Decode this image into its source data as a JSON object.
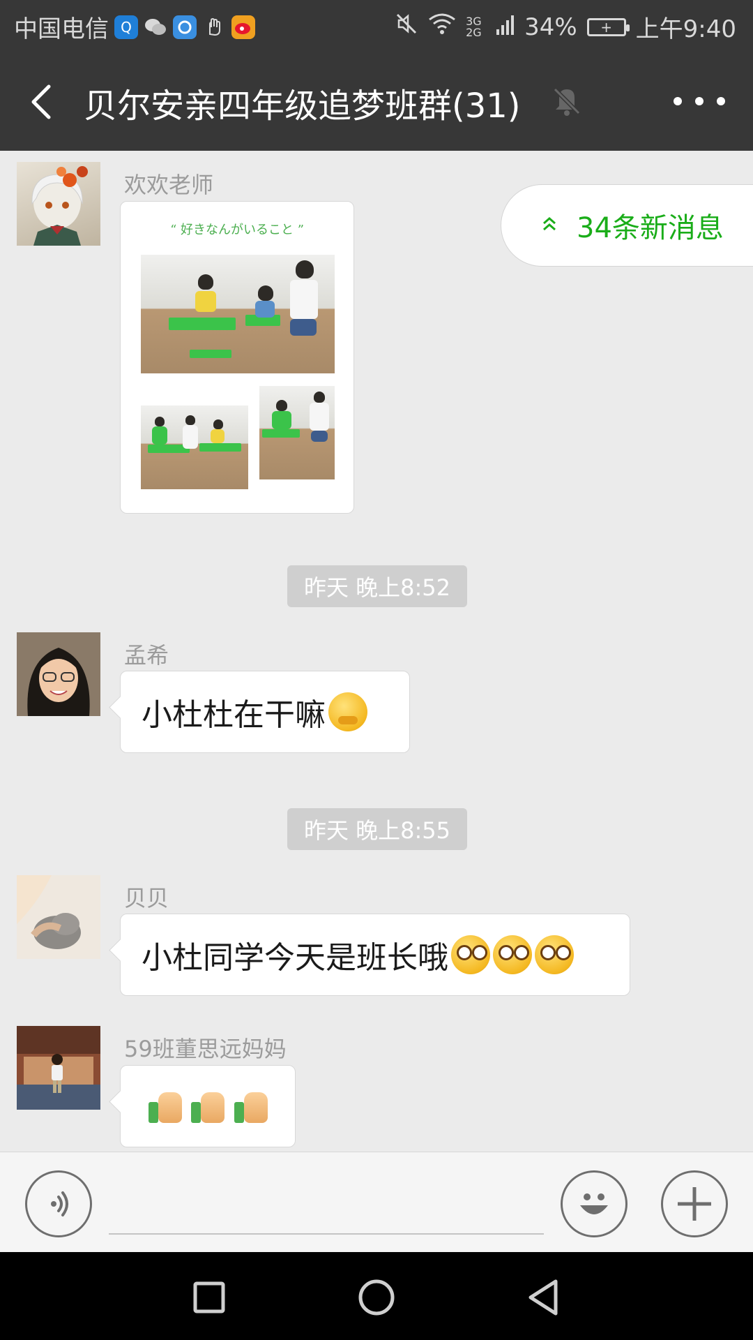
{
  "status_bar": {
    "carrier": "中国电信",
    "battery": "34%",
    "time": "上午9:40",
    "network": "3G 2G",
    "apps": [
      "qq-browser-icon",
      "wechat-icon",
      "qq-icon",
      "hand-icon",
      "weibo-icon"
    ]
  },
  "header": {
    "title": "贝尔安亲四年级追梦班群(31)",
    "back_icon": "chevron-left-icon",
    "mute_icon": "bell-off-icon",
    "more_icon": "more-dots-icon"
  },
  "new_messages_pill": {
    "label": "34条新消息"
  },
  "messages": [
    {
      "sender": "欢欢老师",
      "type": "image",
      "image_caption": "“ 好きなんがいること ”"
    },
    {
      "type": "timestamp",
      "text": "昨天 晚上8:52"
    },
    {
      "sender": "孟希",
      "type": "text",
      "text": "小杜杜在干嘛"
    },
    {
      "type": "timestamp",
      "text": "昨天 晚上8:55"
    },
    {
      "sender": "贝贝",
      "type": "text",
      "text": "小杜同学今天是班长哦"
    },
    {
      "sender": "59班董思远妈妈",
      "type": "emoji",
      "text": ""
    }
  ],
  "input_bar": {
    "voice_icon": "voice-icon",
    "emoji_icon": "smiley-icon",
    "plus_icon": "plus-icon"
  },
  "nav_bar": {
    "buttons": [
      "recents-square-icon",
      "home-circle-icon",
      "back-triangle-icon"
    ]
  },
  "colors": {
    "header_bg": "#373737",
    "chat_bg": "#ebebeb",
    "accent_green": "#1aad19",
    "timestamp_bg": "#cfcfcf"
  }
}
